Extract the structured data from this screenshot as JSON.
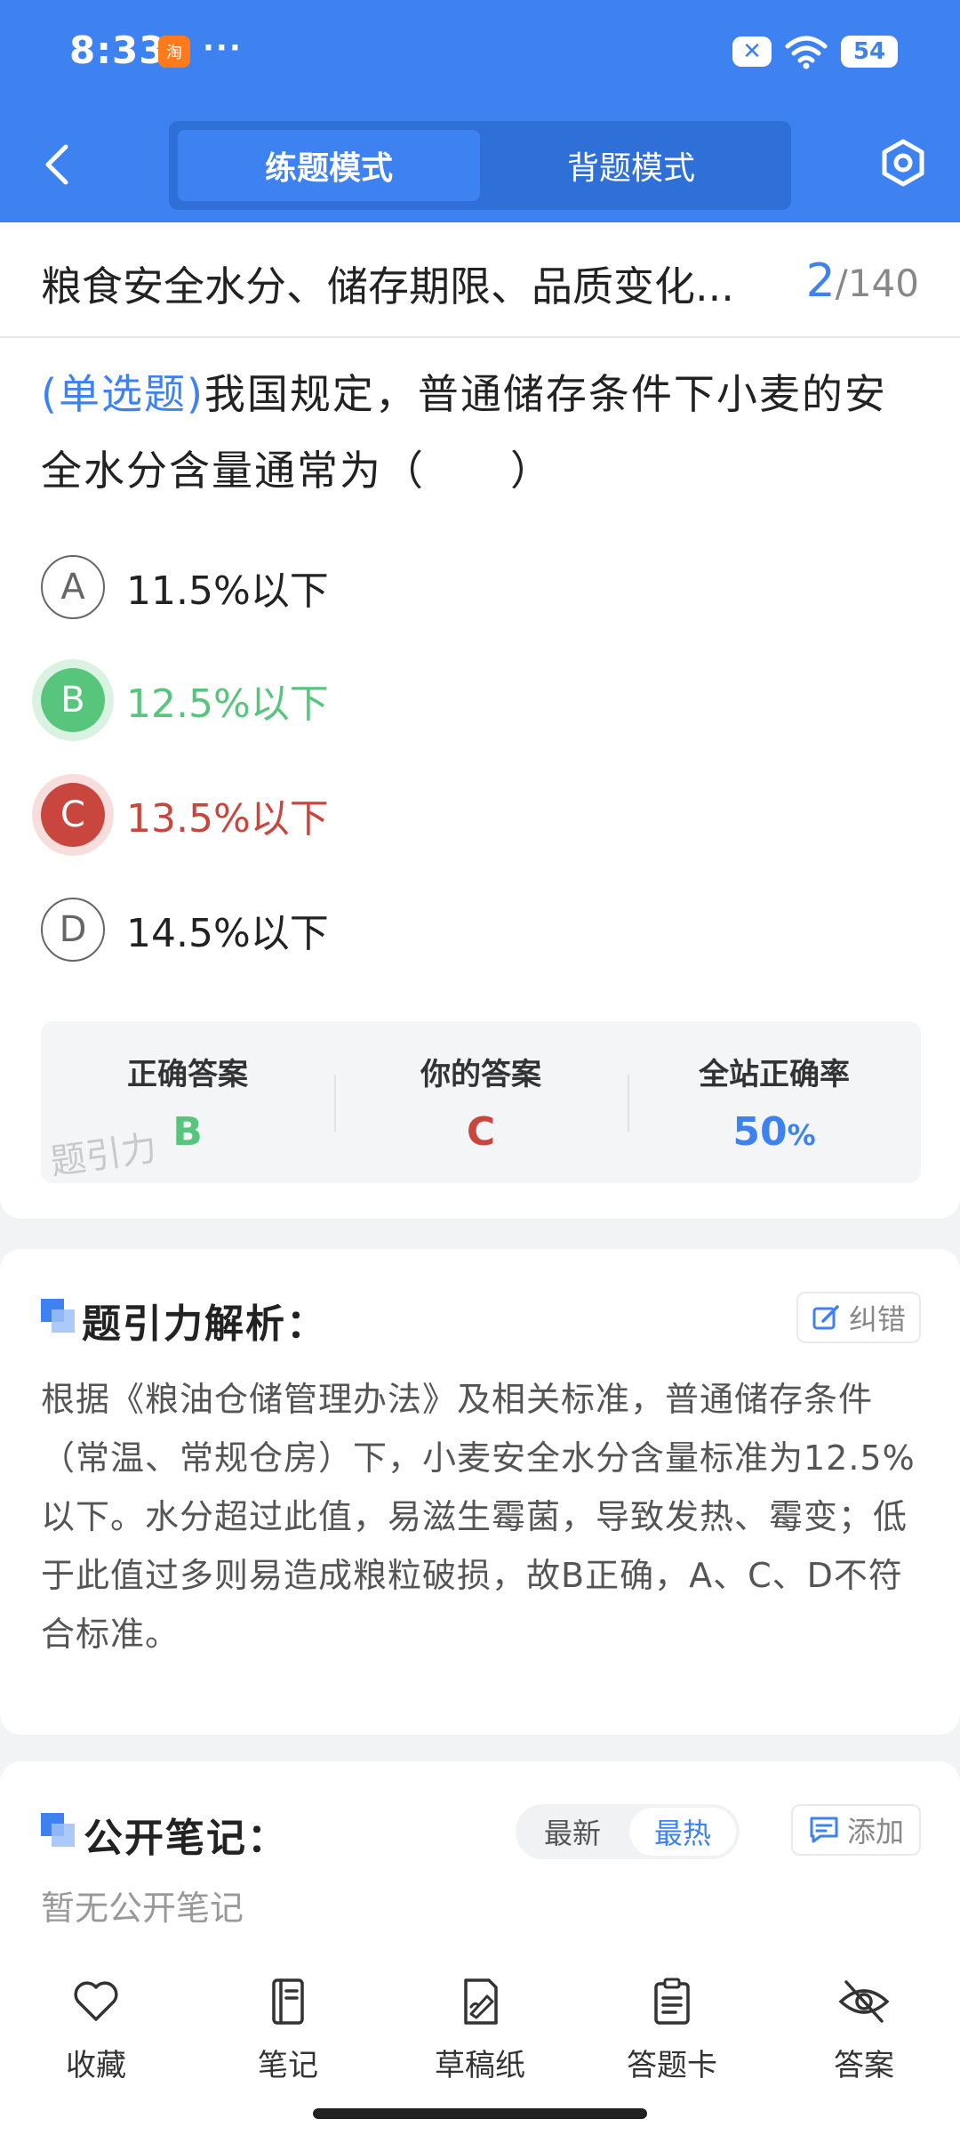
{
  "status_bar": {
    "time": "8:33",
    "app_badge": "淘",
    "more": "···",
    "battery": "54"
  },
  "header": {
    "mode_tabs": [
      {
        "label": "练题模式",
        "active": true
      },
      {
        "label": "背题模式",
        "active": false
      }
    ],
    "accent_color": "#3e82f2"
  },
  "question": {
    "chapter_title": "粮食安全水分、储存期限、品质变化...",
    "current": "2",
    "total": "/140",
    "type": "(单选题)",
    "stem": "我国规定，普通储存条件下小麦的安全水分含量通常为（　　）",
    "options": [
      {
        "letter": "A",
        "text": "11.5%以下",
        "state": "normal"
      },
      {
        "letter": "B",
        "text": "12.5%以下",
        "state": "correct"
      },
      {
        "letter": "C",
        "text": "13.5%以下",
        "state": "wrong"
      },
      {
        "letter": "D",
        "text": "14.5%以下",
        "state": "normal"
      }
    ]
  },
  "answer_summary": {
    "correct_label": "正确答案",
    "correct_value": "B",
    "yours_label": "你的答案",
    "yours_value": "C",
    "rate_label": "全站正确率",
    "rate_value": "50",
    "rate_unit": "%",
    "watermark": "题引力",
    "correct_color": "#58c57d",
    "wrong_color": "#c9463f"
  },
  "analysis": {
    "title": "题引力解析：",
    "report_label": "纠错",
    "text": "根据《粮油仓储管理办法》及相关标准，普通储存条件（常温、常规仓房）下，小麦安全水分含量标准为12.5%以下。水分超过此值，易滋生霉菌，导致发热、霉变；低于此值过多则易造成粮粒破损，故B正确，A、C、D不符合标准。"
  },
  "notes": {
    "title": "公开笔记：",
    "sort_newest": "最新",
    "sort_hottest": "最热",
    "add_label": "添加",
    "empty_text": "暂无公开笔记"
  },
  "bottom_nav": [
    {
      "label": "收藏",
      "icon": "heart-icon"
    },
    {
      "label": "笔记",
      "icon": "notebook-icon"
    },
    {
      "label": "草稿纸",
      "icon": "draft-paper-icon"
    },
    {
      "label": "答题卡",
      "icon": "answer-sheet-icon"
    },
    {
      "label": "答案",
      "icon": "eye-off-icon"
    }
  ]
}
